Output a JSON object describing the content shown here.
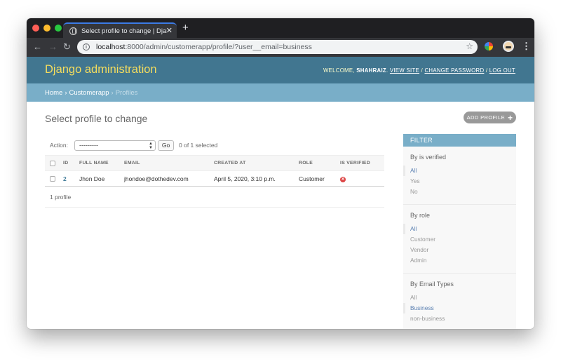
{
  "browser": {
    "tab_title": "Select profile to change | Django site admin",
    "new_tab": "+",
    "close_tab": "✕",
    "url_host": "localhost",
    "url_path": ":8000/admin/customerapp/profile/?user__email=business"
  },
  "header": {
    "branding": "Django administration",
    "welcome": "WELCOME,",
    "username": "SHAHRAIZ",
    "view_site": "VIEW SITE",
    "change_password": "CHANGE PASSWORD",
    "log_out": "LOG OUT"
  },
  "breadcrumbs": {
    "home": "Home",
    "app": "Customerapp",
    "current": "Profiles"
  },
  "content": {
    "title": "Select profile to change",
    "add_button": "ADD PROFILE",
    "action_label": "Action:",
    "action_value": "---------",
    "go_label": "Go",
    "selected_count": "0 of 1 selected",
    "columns": [
      "ID",
      "FULL NAME",
      "EMAIL",
      "CREATED AT",
      "ROLE",
      "IS VERIFIED"
    ],
    "rows": [
      {
        "id": "2",
        "full_name": "Jhon Doe",
        "email": "jhondoe@dothedev.com",
        "created_at": "April 5, 2020, 3:10 p.m.",
        "role": "Customer",
        "is_verified": false
      }
    ],
    "paginator": "1 profile"
  },
  "filter": {
    "title": "FILTER",
    "groups": [
      {
        "title": "By is verified",
        "options": [
          "All",
          "Yes",
          "No"
        ],
        "selected": 0
      },
      {
        "title": "By role",
        "options": [
          "All",
          "Customer",
          "Vendor",
          "Admin"
        ],
        "selected": 0
      },
      {
        "title": "By Email Types",
        "options": [
          "All",
          "Business",
          "non-business"
        ],
        "selected": 1
      }
    ]
  },
  "colors": {
    "header_bg": "#417690",
    "branding": "#f5dd5d",
    "breadcrumb_bg": "#79aec8",
    "link": "#447e9b",
    "filter_selected": "#5b80b2",
    "false_icon": "#dd4646"
  }
}
